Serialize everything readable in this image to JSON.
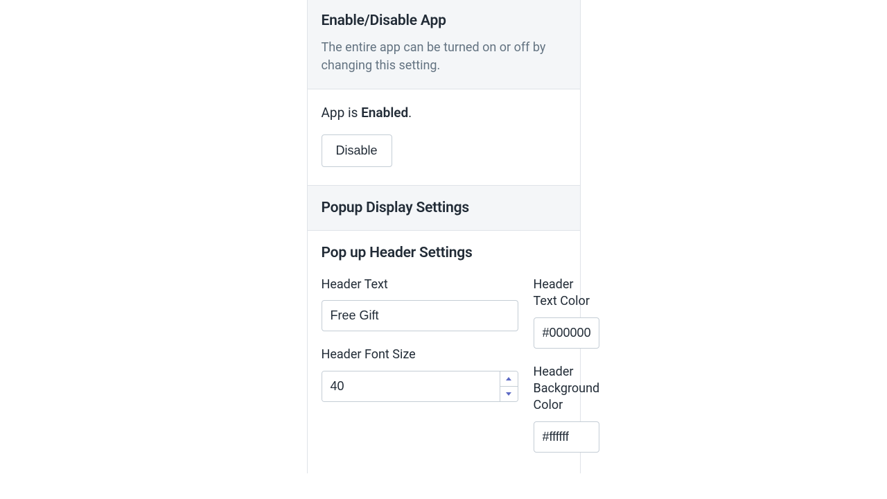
{
  "enable_section": {
    "title": "Enable/Disable App",
    "description": "The entire app can be turned on or off by changing this setting.",
    "status_prefix": "App is ",
    "status_value": "Enabled",
    "status_suffix": ".",
    "button_label": "Disable"
  },
  "popup_section": {
    "title": "Popup Display Settings"
  },
  "header_settings": {
    "title": "Pop up Header Settings",
    "header_text_label": "Header Text",
    "header_text_value": "Free Gift",
    "header_text_color_label": "Header Text Color",
    "header_text_color_value": "#000000",
    "header_font_size_label": "Header Font Size",
    "header_font_size_value": "40",
    "header_bg_color_label": "Header Background Color",
    "header_bg_color_value": "#ffffff"
  }
}
